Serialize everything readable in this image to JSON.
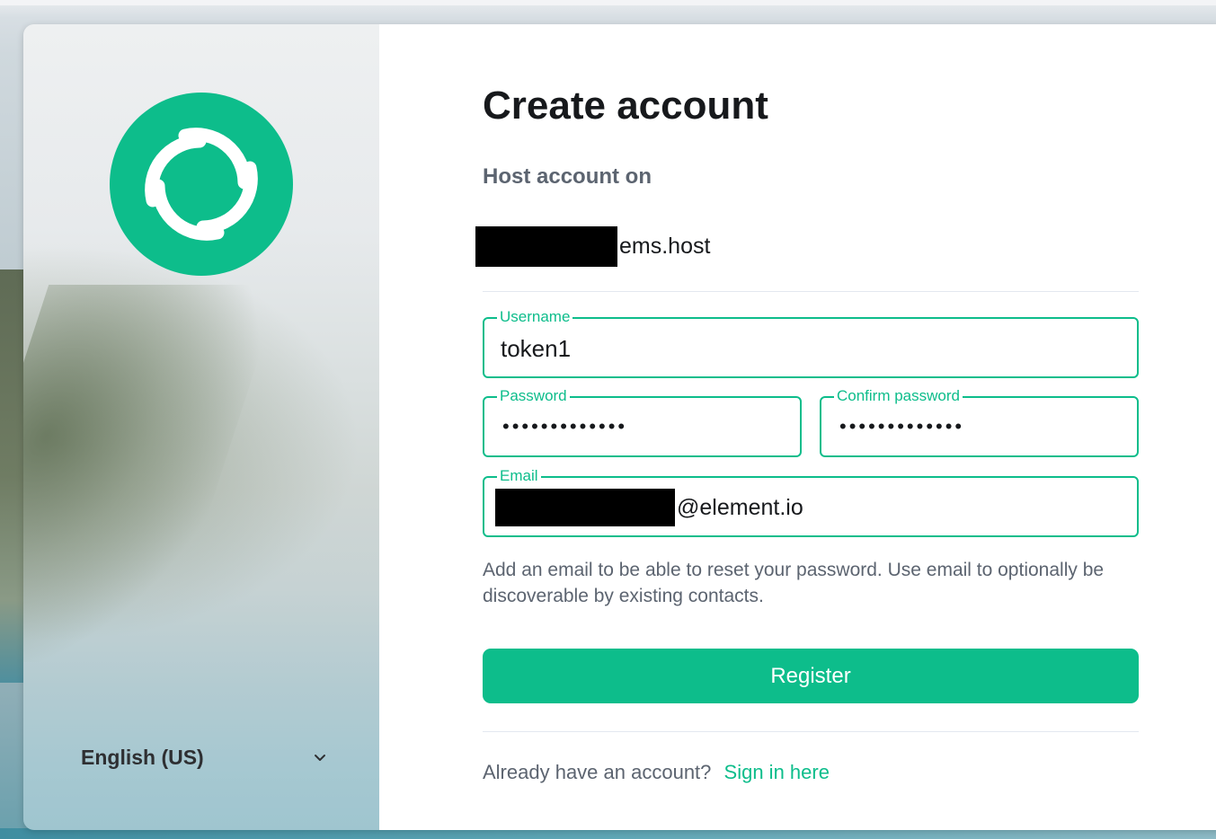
{
  "brand": {
    "accent_color": "#0dbd8b",
    "logo_icon": "element-logo-icon"
  },
  "language": {
    "selected": "English (US)",
    "dropdown_icon": "chevron-down-icon"
  },
  "form": {
    "title": "Create account",
    "host_label": "Host account on",
    "server_suffix": "ems.host",
    "username": {
      "label": "Username",
      "value": "token1"
    },
    "password": {
      "label": "Password",
      "value": "•••••••••••••"
    },
    "confirm_password": {
      "label": "Confirm password",
      "value": "•••••••••••••"
    },
    "email": {
      "label": "Email",
      "value_suffix": "@element.io"
    },
    "help_text": "Add an email to be able to reset your password. Use email to optionally be discoverable by existing contacts.",
    "register_label": "Register",
    "signin_prompt": "Already have an account?",
    "signin_link": "Sign in here"
  }
}
